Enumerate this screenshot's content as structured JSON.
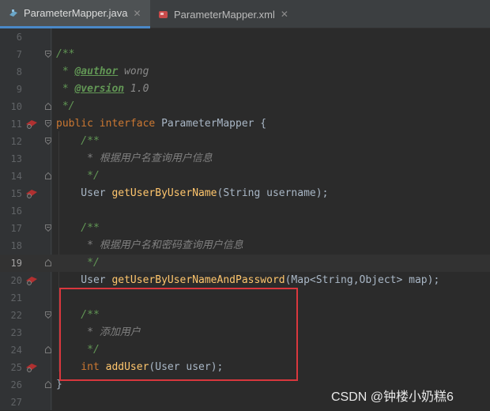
{
  "tabs": [
    {
      "label": "ParameterMapper.java",
      "icon": "java-interface-icon",
      "active": true,
      "close": "✕"
    },
    {
      "label": "ParameterMapper.xml",
      "icon": "xml-mapper-icon",
      "active": false,
      "close": "✕"
    }
  ],
  "editor": {
    "current_line": "19",
    "lines": [
      {
        "num": "6"
      },
      {
        "num": "7",
        "t": "/**"
      },
      {
        "num": "8",
        "t1": " * ",
        "tag": "@author",
        "t2": " wong"
      },
      {
        "num": "9",
        "t1": " * ",
        "tag": "@version",
        "t2": " 1.0"
      },
      {
        "num": "10",
        "t": " */"
      },
      {
        "num": "11",
        "kw1": "public",
        "kw2": "interface",
        "name": "ParameterMapper",
        "rest": " {"
      },
      {
        "num": "12",
        "t": "    /**"
      },
      {
        "num": "13",
        "t": "     * 根据用户名查询用户信息"
      },
      {
        "num": "14",
        "t": "     */"
      },
      {
        "num": "15",
        "type": "    User ",
        "fn": "getUserByUserName",
        "params": "(String username);"
      },
      {
        "num": "16"
      },
      {
        "num": "17",
        "t": "    /**"
      },
      {
        "num": "18",
        "t": "     * 根据用户名和密码查询用户信息"
      },
      {
        "num": "19",
        "t": "     */"
      },
      {
        "num": "20",
        "type": "    User ",
        "fn": "getUserByUserNameAndPassword",
        "params": "(Map<String,Object> map);"
      },
      {
        "num": "21"
      },
      {
        "num": "22",
        "t": "    /**"
      },
      {
        "num": "23",
        "t": "     * 添加用户"
      },
      {
        "num": "24",
        "t": "     */"
      },
      {
        "num": "25",
        "kw": "    int ",
        "fn": "addUser",
        "params": "(User user);"
      },
      {
        "num": "26",
        "t": "}"
      },
      {
        "num": "27"
      }
    ]
  },
  "watermark": "CSDN @钟楼小奶糕6"
}
